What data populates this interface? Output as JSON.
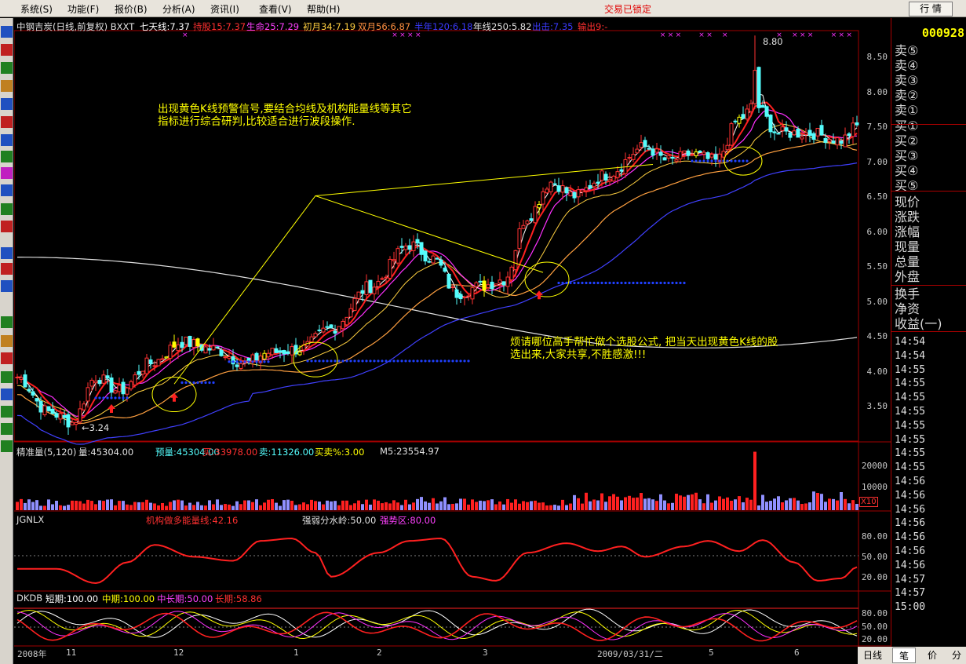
{
  "menu": [
    {
      "label": "系统(S)"
    },
    {
      "label": "功能(F)"
    },
    {
      "label": "报价(B)"
    },
    {
      "label": "分析(A)"
    },
    {
      "label": "资讯(I)"
    },
    {
      "label": "查看(V)"
    },
    {
      "label": "帮助(H)"
    }
  ],
  "lock_status": "交易已锁定",
  "market_button": "行 情",
  "stock_code": "000928",
  "main_header": {
    "title": "中钢吉炭(日线,前复权) BXXT",
    "ma7": "七天线:7.37",
    "hold": "持股15:7.37",
    "life": "生命25:7.29",
    "yue": "初月34:7.19",
    "shuang": "双月56:6.87",
    "bn": "半年120:6.18",
    "year": "年线250:5.82",
    "exit": "出击:7.35",
    "output": "输出9:-"
  },
  "vol_header": {
    "name": "精准量(5,120)",
    "vol": "量:45304.00",
    "pre": "预量:45304.00",
    "buy": "买:33978.00",
    "sell": "卖:11326.00",
    "pct": "买卖%:3.00",
    "m5": "M5:23554.97"
  },
  "jg_header": {
    "name": "JGNLX",
    "jg": "机构做多能量线:42.16",
    "qr": "强弱分水岭:50.00",
    "qs": "强势区:80.00"
  },
  "dk_header": {
    "name": "DKDB",
    "short": "短期:100.00",
    "mid": "中期:100.00",
    "ml": "中长期:50.00",
    "long": "长期:58.86"
  },
  "annotations": {
    "a1_line1": "出现黄色K线预警信号,要结合均线及机构能量线等其它",
    "a1_line2": "指标进行综合研判,比较适合进行波段操作.",
    "a2_line1": "烦请哪位高手帮忙做个选股公式, 把当天出现黄色K线的股",
    "a2_line2": "选出来,大家共享,不胜感激!!!"
  },
  "price_labels": {
    "max": "8.80",
    "min": "←3.24"
  },
  "y_price": [
    "8.50",
    "8.00",
    "7.50",
    "7.00",
    "6.50",
    "6.00",
    "5.50",
    "5.00",
    "4.50",
    "4.00",
    "3.50"
  ],
  "y_vol": [
    "20000",
    "10000"
  ],
  "vol_unit": "X10",
  "y_jg": [
    "80.00",
    "50.00",
    "20.00"
  ],
  "y_dk": [
    "80.00",
    "50.00",
    "20.00"
  ],
  "x_dates": [
    "2008年",
    "11",
    "12",
    "1",
    "2",
    "3",
    "2009/03/31/二",
    "5",
    "6"
  ],
  "quote_labels": [
    "卖⑤",
    "卖④",
    "卖③",
    "卖②",
    "卖①",
    "买①",
    "买②",
    "买③",
    "买④",
    "买⑤",
    "现价",
    "涨跌",
    "涨幅",
    "现量",
    "总量",
    "外盘",
    "换手",
    "净资",
    "收益(一)"
  ],
  "ticks": [
    "14:54",
    "14:54",
    "14:55",
    "14:55",
    "14:55",
    "14:55",
    "14:55",
    "14:55",
    "14:55",
    "14:55",
    "14:56",
    "14:56",
    "14:56",
    "14:56",
    "14:56",
    "14:56",
    "14:56",
    "14:57",
    "14:57",
    "15:00"
  ],
  "bottom_tabs": [
    "日线",
    "笔",
    "价",
    "分"
  ],
  "colors": {
    "up": "#ff3232",
    "down": "#54fcfc",
    "yellow": "#ffff00",
    "ma1": "#ffffff",
    "ma2": "#ff2020",
    "ma3": "#ff30ff",
    "ma4": "#ffa040",
    "ma5": "#4040ff",
    "year": "#e0e0e0"
  },
  "chart_data": {
    "type": "candlestick",
    "title": "中钢吉炭(日线,前复权)",
    "ylim": [
      3.0,
      9.0
    ],
    "max": 8.8,
    "min": 3.24,
    "series_close_knots": [
      [
        0,
        3.9
      ],
      [
        8,
        3.4
      ],
      [
        14,
        3.25
      ],
      [
        20,
        3.9
      ],
      [
        26,
        3.7
      ],
      [
        34,
        4.1
      ],
      [
        42,
        4.4
      ],
      [
        50,
        4.3
      ],
      [
        58,
        4.1
      ],
      [
        64,
        4.25
      ],
      [
        72,
        4.3
      ],
      [
        80,
        4.6
      ],
      [
        90,
        5.2
      ],
      [
        100,
        5.8
      ],
      [
        106,
        5.6
      ],
      [
        112,
        5.1
      ],
      [
        118,
        5.2
      ],
      [
        124,
        5.3
      ],
      [
        130,
        6.2
      ],
      [
        136,
        6.7
      ],
      [
        142,
        6.5
      ],
      [
        150,
        6.8
      ],
      [
        160,
        7.2
      ],
      [
        166,
        7.0
      ],
      [
        172,
        7.1
      ],
      [
        178,
        7.0
      ],
      [
        184,
        7.6
      ],
      [
        188,
        7.8
      ],
      [
        194,
        7.4
      ],
      [
        202,
        7.4
      ],
      [
        210,
        7.3
      ],
      [
        214,
        7.5
      ]
    ],
    "volume_peak": 20000,
    "jgnlx_knots": [
      [
        0,
        40
      ],
      [
        10,
        40
      ],
      [
        20,
        22
      ],
      [
        28,
        48
      ],
      [
        35,
        70
      ],
      [
        45,
        55
      ],
      [
        55,
        50
      ],
      [
        62,
        75
      ],
      [
        70,
        78
      ],
      [
        76,
        60
      ],
      [
        80,
        30
      ],
      [
        92,
        60
      ],
      [
        100,
        75
      ],
      [
        108,
        78
      ],
      [
        116,
        30
      ],
      [
        122,
        25
      ],
      [
        130,
        60
      ],
      [
        140,
        72
      ],
      [
        148,
        62
      ],
      [
        154,
        68
      ],
      [
        160,
        55
      ],
      [
        170,
        68
      ],
      [
        176,
        75
      ],
      [
        184,
        62
      ],
      [
        190,
        76
      ],
      [
        198,
        48
      ],
      [
        204,
        25
      ],
      [
        210,
        28
      ],
      [
        214,
        42
      ]
    ]
  }
}
